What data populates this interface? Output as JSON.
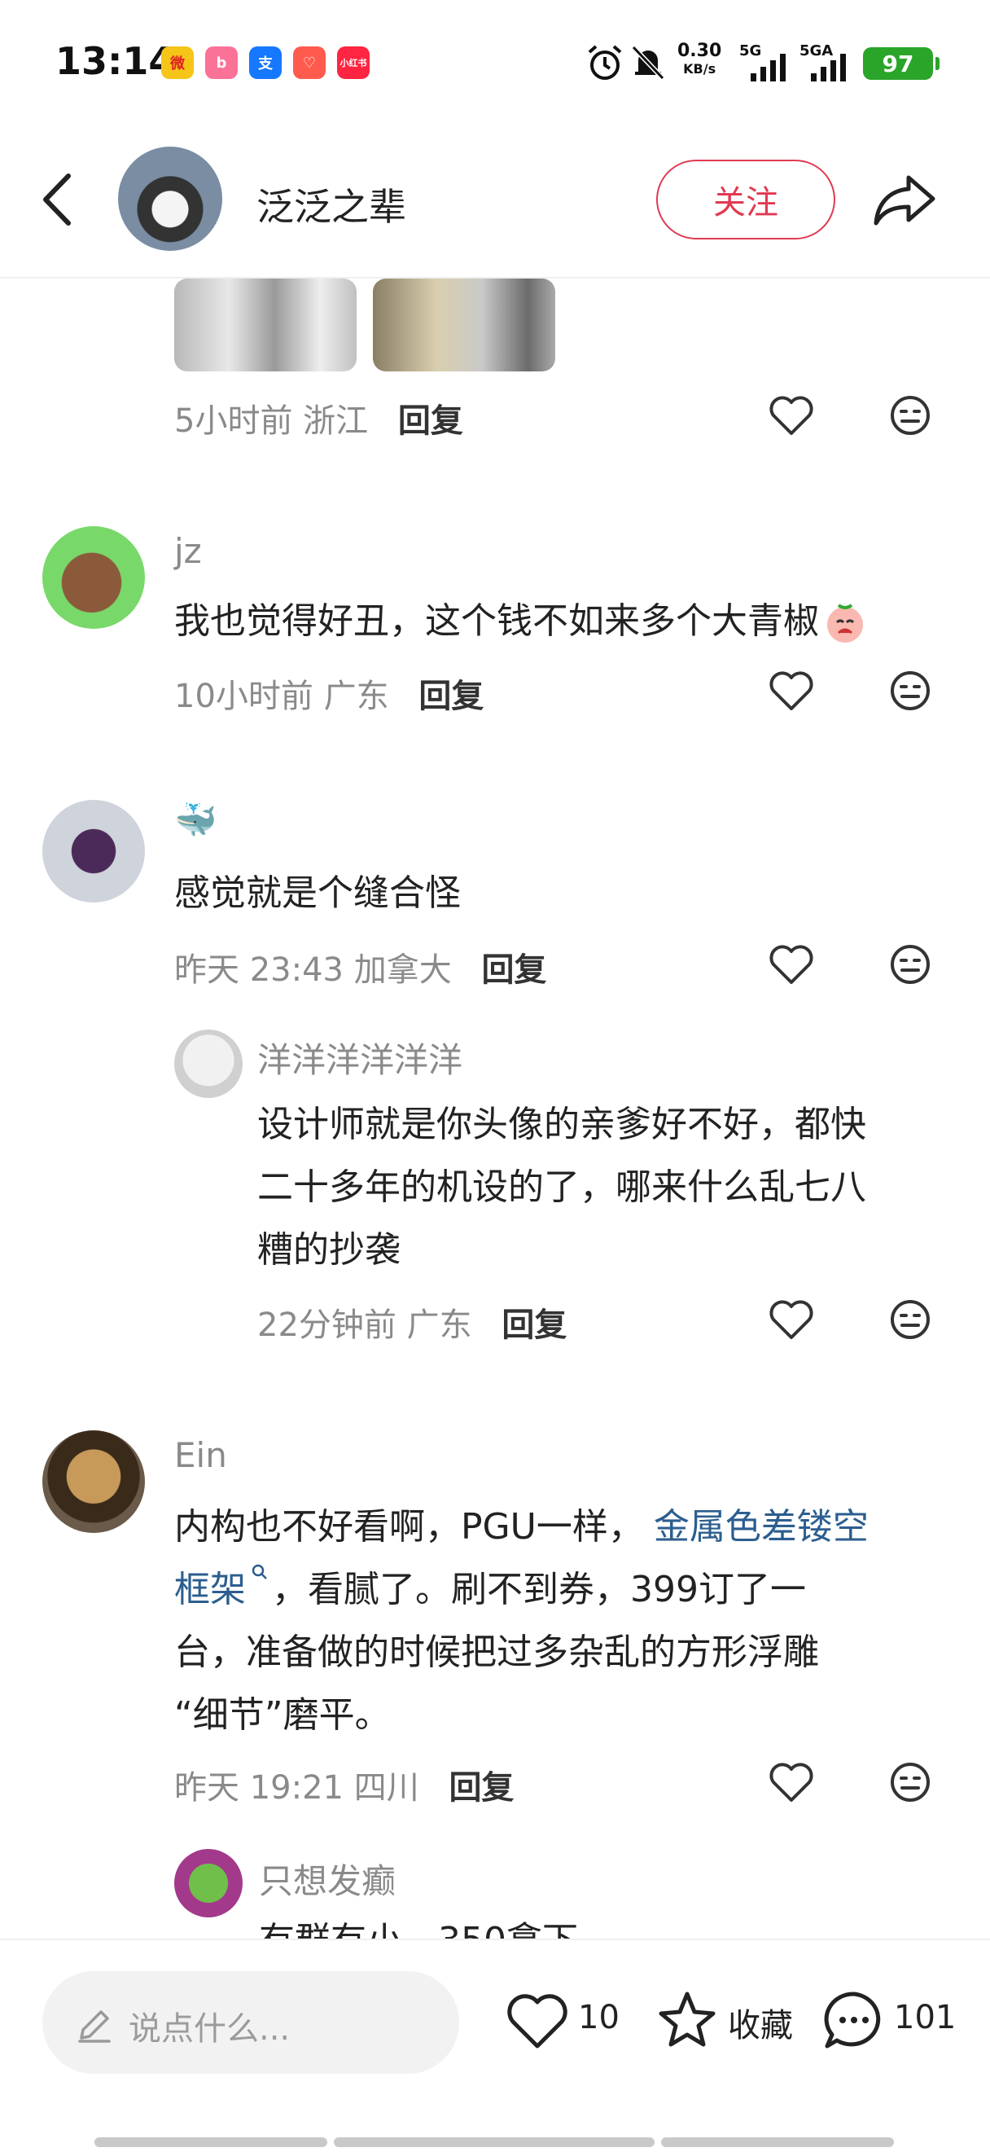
{
  "status_bar": {
    "time": "13:14",
    "app_icons": [
      {
        "name": "weibo-icon",
        "color": "#f5c518",
        "glyph": "微"
      },
      {
        "name": "bilibili-icon",
        "color": "#fb7299",
        "glyph": "b"
      },
      {
        "name": "alipay-icon",
        "color": "#1677ff",
        "glyph": "支"
      },
      {
        "name": "health-icon",
        "color": "#ff5a4e",
        "glyph": "♡"
      },
      {
        "name": "xiaohongshu-icon",
        "color": "#ff2442",
        "glyph": "小红书"
      }
    ],
    "net_speed": "0.30",
    "net_unit": "KB/s",
    "signal1": "5G",
    "signal2": "5GA",
    "battery": "97",
    "battery_color": "#2aa52a"
  },
  "header": {
    "author": "泛泛之辈",
    "follow_label": "关注"
  },
  "comments": [
    {
      "time": "5小时前",
      "region": "浙江",
      "reply_label": "回复"
    },
    {
      "user": "jz",
      "text": "我也觉得好丑，这个钱不如来多个大青椒",
      "time": "10小时前",
      "region": "广东",
      "reply_label": "回复"
    },
    {
      "user": "🐳",
      "text": "感觉就是个缝合怪",
      "time": "昨天 23:43",
      "region": "加拿大",
      "reply_label": "回复",
      "sub": {
        "user": "洋洋洋洋洋洋",
        "line1": "设计师就是你头像的亲爹好不好，都快",
        "line2": "二十多年的机设的了，哪来什么乱七八",
        "line3": "糟的抄袭",
        "time": "22分钟前",
        "region": "广东",
        "reply_label": "回复"
      }
    },
    {
      "user": "Ein",
      "line1_a": "内构也不好看啊，PGU一样，",
      "line1_link": "金属色差镂空",
      "line2_link": "框架",
      "line2_b": "，看腻了。刷不到券，399订了一",
      "line3": "台，准备做的时候把过多杂乱的方形浮雕",
      "line4": "“细节”磨平。",
      "time": "昨天 19:21",
      "region": "四川",
      "reply_label": "回复",
      "sub": {
        "user": "只想发癫",
        "partial": "有群有小，350拿下"
      }
    }
  ],
  "bottom_bar": {
    "input_placeholder": "说点什么...",
    "like_count": "10",
    "collect_label": "收藏",
    "comment_count": "101"
  },
  "colors": {
    "accent": "#e03a52",
    "link": "#2c5e8f",
    "meta": "#8a8a8a"
  }
}
